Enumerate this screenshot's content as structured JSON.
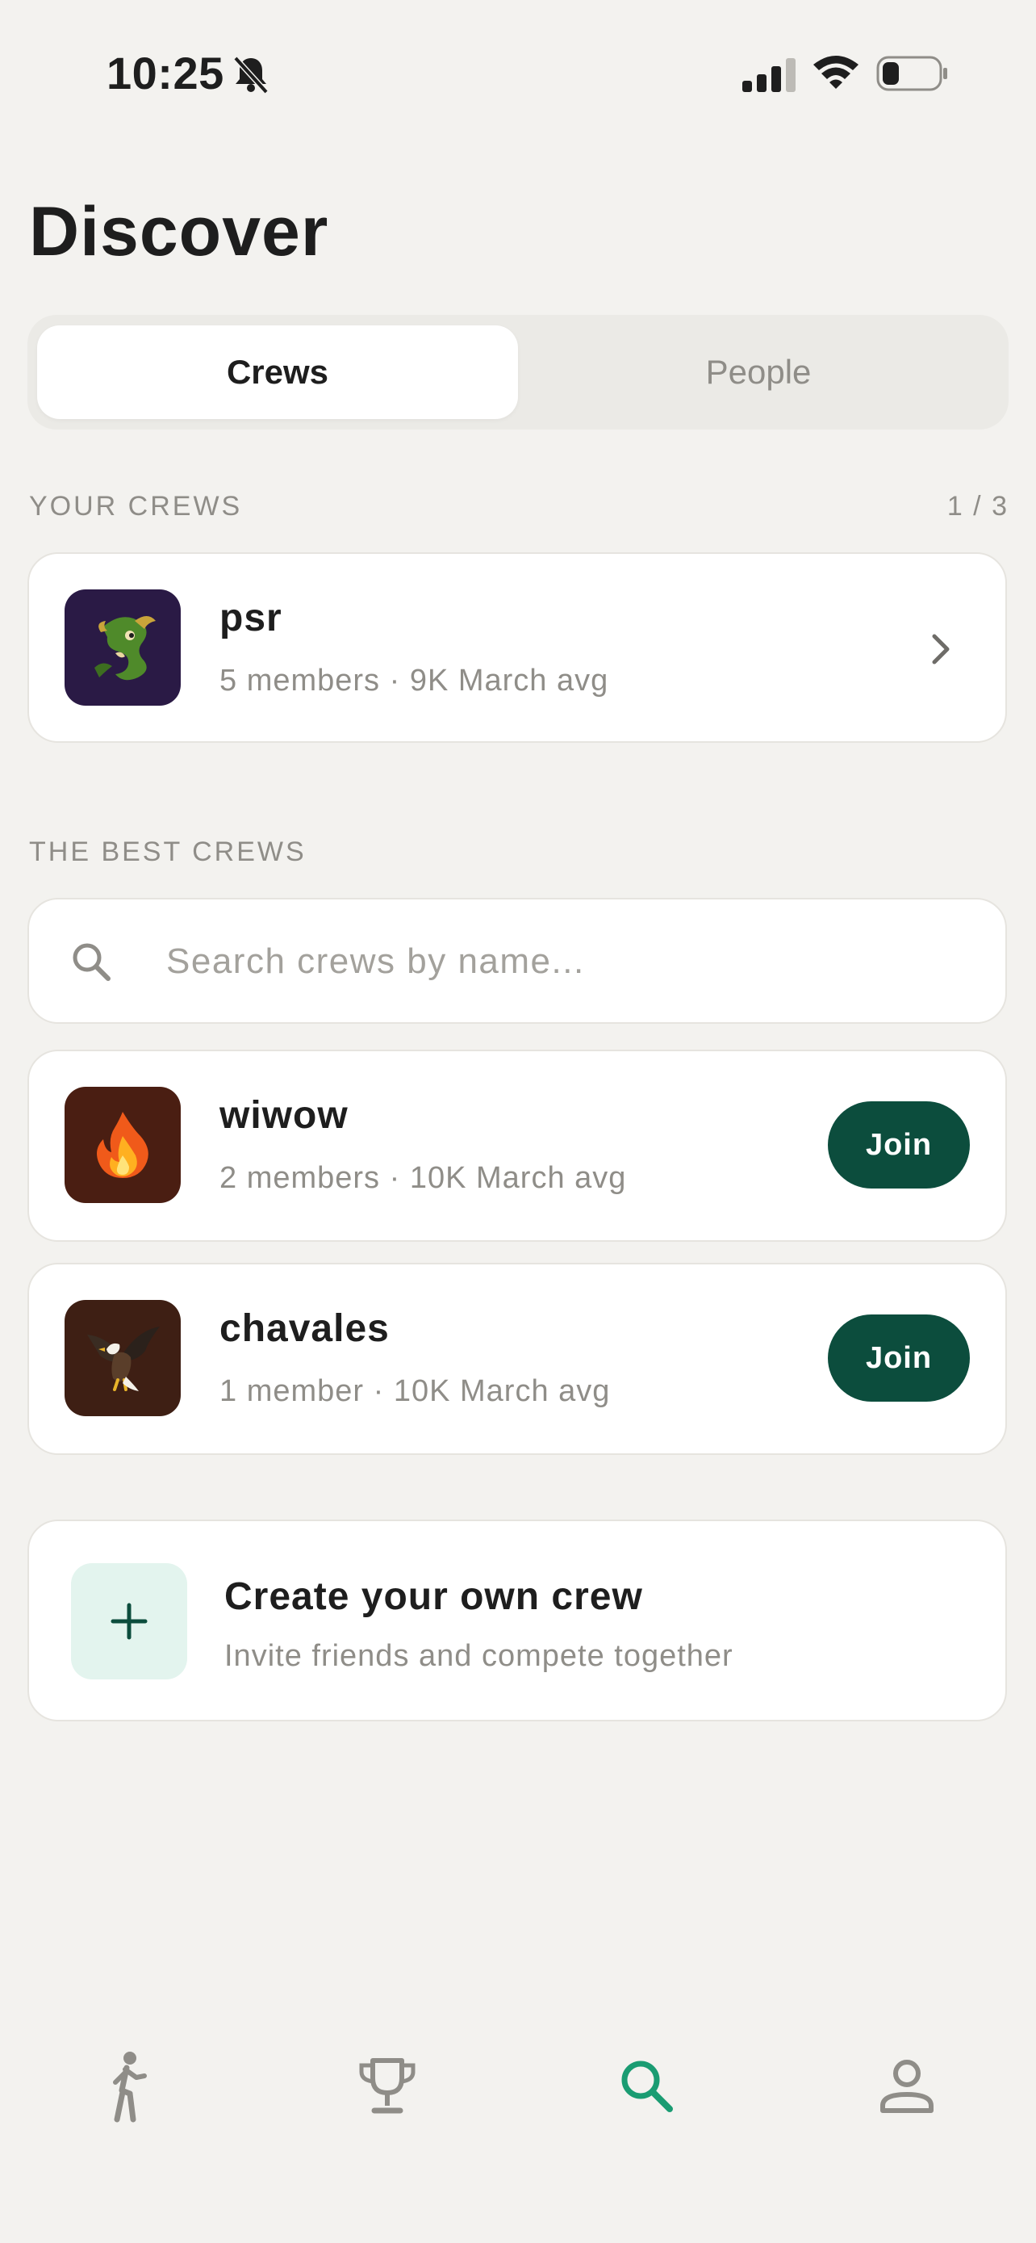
{
  "status_bar": {
    "time": "10:25"
  },
  "page": {
    "title": "Discover"
  },
  "segments": {
    "crews": "Crews",
    "people": "People",
    "selected": "Crews"
  },
  "your_crews": {
    "label": "YOUR CREWS",
    "count": "1 / 3",
    "items": [
      {
        "name": "psr",
        "meta": "5 members · 9K March avg",
        "avatar_icon": "dragon-icon"
      }
    ]
  },
  "best_crews": {
    "label": "THE BEST CREWS",
    "search_placeholder": "Search crews by name...",
    "items": [
      {
        "name": "wiwow",
        "meta": "2 members · 10K March avg",
        "avatar_icon": "fire-icon",
        "action": "Join"
      },
      {
        "name": "chavales",
        "meta": "1 member · 10K March avg",
        "avatar_icon": "eagle-icon",
        "action": "Join"
      }
    ]
  },
  "create": {
    "title": "Create your own crew",
    "subtitle": "Invite friends and compete together"
  },
  "tab_bar": {
    "items": [
      {
        "icon": "walking-icon"
      },
      {
        "icon": "trophy-icon"
      },
      {
        "icon": "search-icon",
        "active": true
      },
      {
        "icon": "profile-icon"
      }
    ]
  },
  "colors": {
    "background": "#F3F2EF",
    "accent": "#0C4D3D",
    "active_tab": "#1A9C72",
    "muted_text": "#8F8D88",
    "card": "#FFFFFF"
  }
}
